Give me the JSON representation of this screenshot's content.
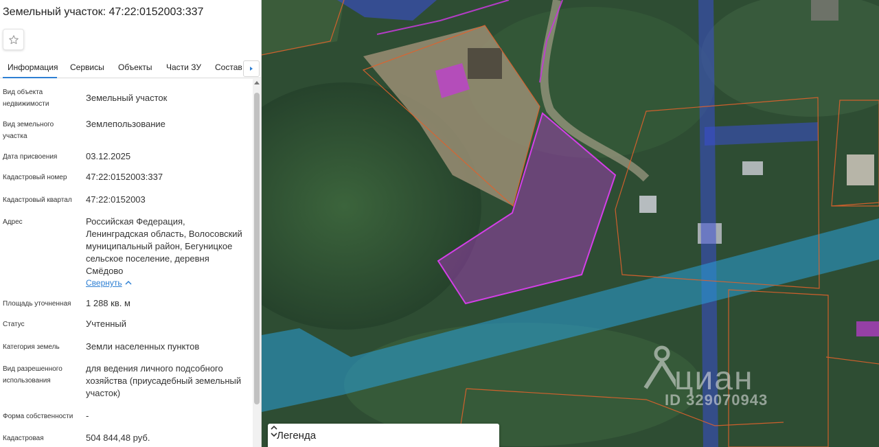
{
  "panel": {
    "title": "Земельный участок: 47:22:0152003:337",
    "favorite_icon": "star-outline-icon",
    "tabs": [
      {
        "label": "Информация",
        "active": true
      },
      {
        "label": "Сервисы"
      },
      {
        "label": "Объекты"
      },
      {
        "label": "Части ЗУ"
      },
      {
        "label": "Состав"
      }
    ],
    "tabs_scroll_icon": "caret-right-icon",
    "fields": [
      {
        "label": "Вид объекта недвижимости",
        "value": "Земельный участок"
      },
      {
        "label": "Вид земельного участка",
        "value": "Землепользование"
      },
      {
        "label": "Дата присвоения",
        "value": "03.12.2025"
      },
      {
        "label": "Кадастровый номер",
        "value": "47:22:0152003:337"
      },
      {
        "label": "Кадастровый квартал",
        "value": "47:22:0152003"
      },
      {
        "label": "Адрес",
        "value": "Российская Федерация, Ленинградская область, Волосовский муниципальный район, Бегуницкое сельское поселение, деревня Смёдово"
      },
      {
        "label": "Площадь уточненная",
        "value": "1 288 кв. м"
      },
      {
        "label": "Статус",
        "value": "Учтенный"
      },
      {
        "label": "Категория земель",
        "value": "Земли населенных пунктов"
      },
      {
        "label": "Вид разрешенного использования",
        "value": "для ведения личного подсобного хозяйства (приусадебный земельный участок)"
      },
      {
        "label": "Форма собственности",
        "value": "-"
      },
      {
        "label": "Кадастровая",
        "value": "504 844,48 руб."
      }
    ],
    "address_collapse_label": "Свернуть"
  },
  "map": {
    "legend_label": "Легенда",
    "legend_toggle_icon": "chevron-up-down-icon",
    "watermark_brand": "циан",
    "watermark_id": "ID 329070943",
    "colors": {
      "selected_parcel": "#c23bd6",
      "parcel_border": "#e0622c",
      "water_zone": "#2aa0d8",
      "blue_zone": "#3a4fd0"
    }
  }
}
